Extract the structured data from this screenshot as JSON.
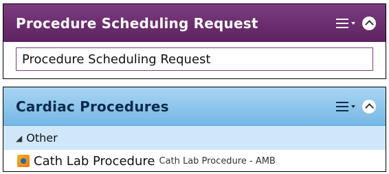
{
  "panels": [
    {
      "title": "Procedure Scheduling Request",
      "field_value": "Procedure Scheduling Request"
    },
    {
      "title": "Cardiac Procedures",
      "group_label": "Other",
      "items": [
        {
          "name": "Cath Lab Procedure",
          "description": "Cath Lab Procedure - AMB"
        }
      ]
    }
  ],
  "colors": {
    "panel1_header": "#6b2e6e",
    "panel2_header": "#8cc5ee"
  },
  "icons": {
    "menu": "menu-icon",
    "collapse": "collapse-icon",
    "procedure": "procedure-icon",
    "group_toggle": "triangle-icon"
  }
}
